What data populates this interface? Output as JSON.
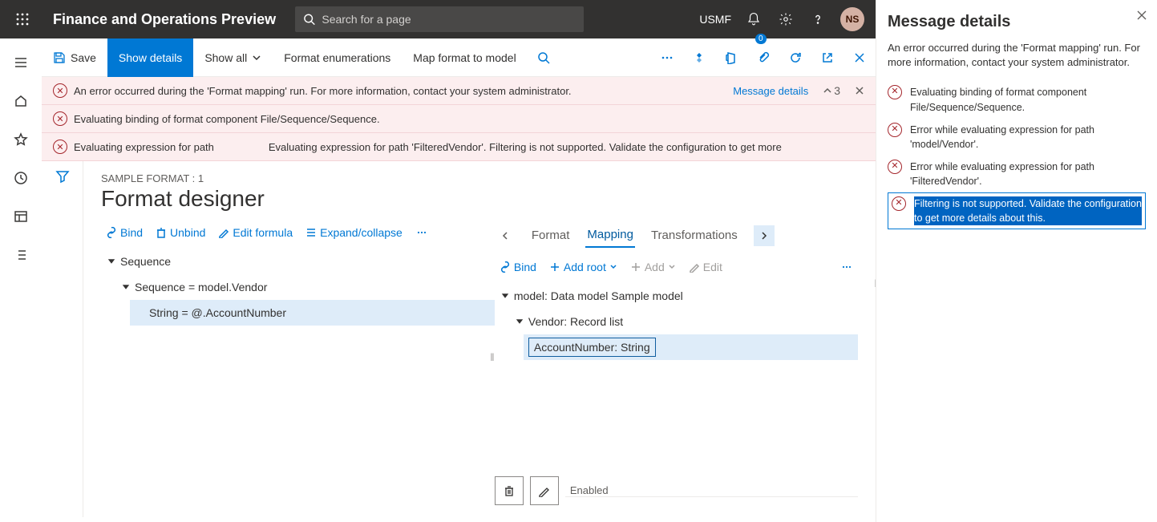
{
  "header": {
    "app_title": "Finance and Operations Preview",
    "search_placeholder": "Search for a page",
    "legal_entity": "USMF",
    "avatar_initials": "NS"
  },
  "action_bar": {
    "save": "Save",
    "show_details": "Show details",
    "show_all": "Show all",
    "format_enum": "Format enumerations",
    "map_format": "Map format to model",
    "attachment_badge": "0"
  },
  "messages": {
    "m1": "An error occurred during the 'Format mapping' run. For more information, contact your system administrator.",
    "m2": "Evaluating binding of format component File/Sequence/Sequence.",
    "m3a": "Evaluating expression for path",
    "m3b": "Evaluating expression for path 'FilteredVendor'. Filtering is not supported. Validate the configuration to get more",
    "details_link": "Message details",
    "count": "3"
  },
  "designer": {
    "breadcrumb": "SAMPLE FORMAT : 1",
    "title": "Format designer",
    "left_tb": {
      "bind": "Bind",
      "unbind": "Unbind",
      "edit_formula": "Edit formula",
      "expand": "Expand/collapse"
    },
    "tabs": {
      "format": "Format",
      "mapping": "Mapping",
      "transformations": "Transformations"
    },
    "right_tb": {
      "bind": "Bind",
      "add_root": "Add root",
      "add": "Add",
      "edit": "Edit"
    },
    "tree_left": {
      "n1": "Sequence",
      "n2": "Sequence = model.Vendor",
      "n3": "String = @.AccountNumber"
    },
    "tree_right": {
      "n1": "model: Data model Sample model",
      "n2": "Vendor: Record list",
      "n3": "AccountNumber: String"
    },
    "enabled_label": "Enabled"
  },
  "panel": {
    "title": "Message details",
    "desc": "An error occurred during the 'Format mapping' run. For more information, contact your system administrator.",
    "items": [
      "Evaluating binding of format component File/Sequence/Sequence.",
      "Error while evaluating expression for path 'model/Vendor'.",
      "Error while evaluating expression for path 'FilteredVendor'.",
      "Filtering is not supported. Validate the configuration to get more details about this."
    ]
  }
}
